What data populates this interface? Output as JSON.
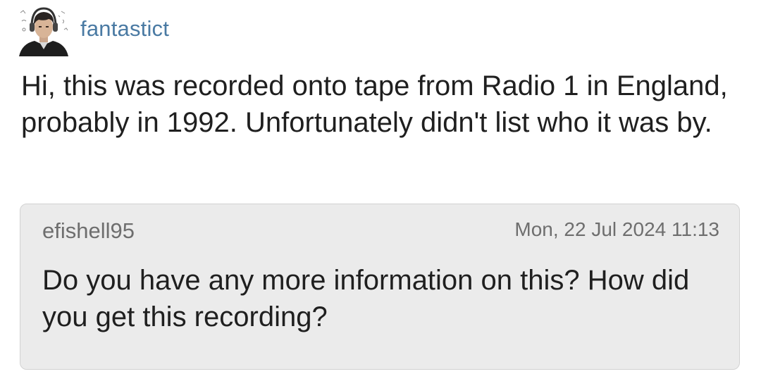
{
  "post": {
    "author": "fantastict",
    "avatar_icon": "user-avatar-headphones",
    "body": "Hi, this was recorded onto tape from Radio 1 in England, probably in 1992. Unfortunately didn't list who it was by."
  },
  "reply": {
    "author": "efishell95",
    "timestamp": "Mon, 22 Jul 2024 11:13",
    "body": "Do you have any more information on this? How did you get this recording?"
  },
  "colors": {
    "username": "#4a7aa3",
    "reply_background": "#ebebeb",
    "reply_border": "#d2d2d2",
    "muted_text": "#6e6e6e",
    "body_text": "#1f1f1f"
  }
}
